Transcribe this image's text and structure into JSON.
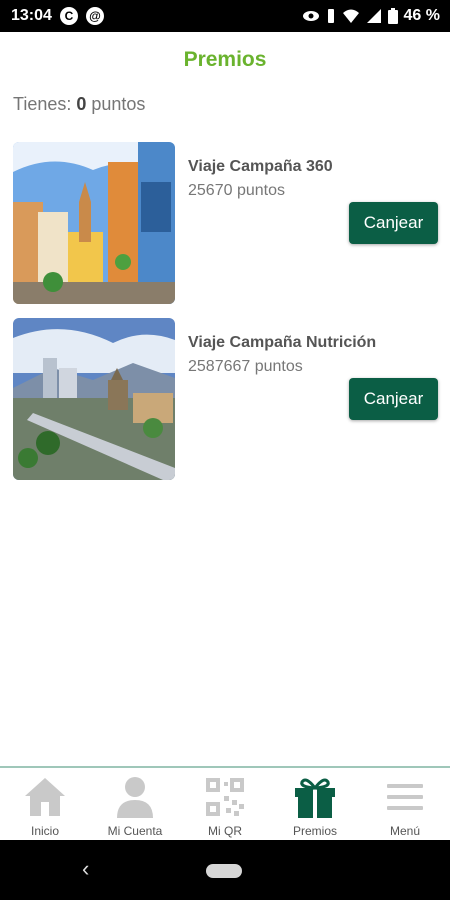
{
  "status": {
    "time": "13:04",
    "battery": "46 %"
  },
  "header": {
    "title": "Premios"
  },
  "points": {
    "prefix": "Tienes: ",
    "value": "0",
    "suffix": " puntos"
  },
  "prizes": [
    {
      "name": "Viaje Campaña 360",
      "points": "25670 puntos",
      "button": "Canjear"
    },
    {
      "name": "Viaje Campaña Nutrición",
      "points": "2587667 puntos",
      "button": "Canjear"
    }
  ],
  "tabs": [
    {
      "label": "Inicio",
      "icon": "home-icon"
    },
    {
      "label": "Mi Cuenta",
      "icon": "user-icon"
    },
    {
      "label": "Mi QR",
      "icon": "qr-icon"
    },
    {
      "label": "Premios",
      "icon": "gift-icon"
    },
    {
      "label": "Menú",
      "icon": "menu-icon"
    }
  ],
  "colors": {
    "accent": "#6ab32e",
    "button": "#0b5e45",
    "tab_active": "#0b5e45",
    "tab_inactive": "#c9c9c9"
  }
}
